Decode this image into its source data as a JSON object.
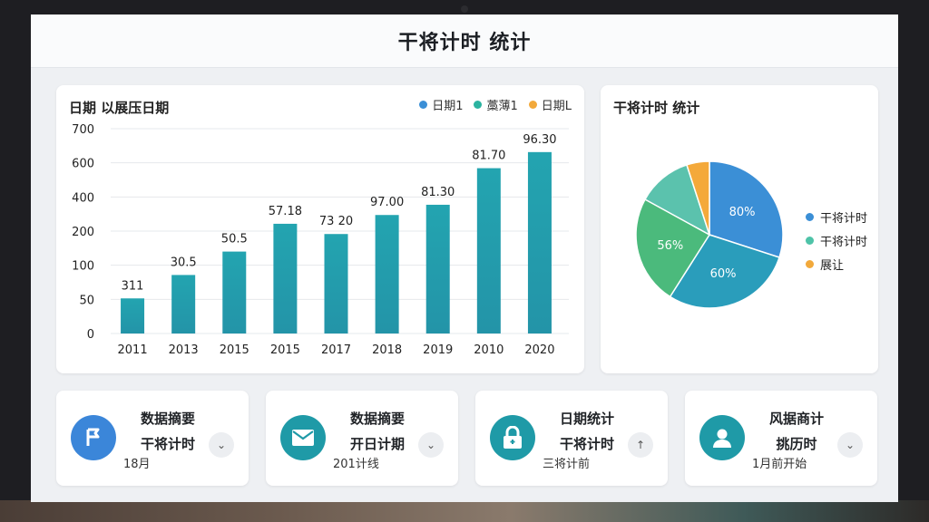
{
  "header": {
    "title": "干将计时 统计"
  },
  "bar_chart": {
    "title": "日期 以展压日期",
    "legend": [
      {
        "label": "日期1",
        "color": "#3b8fd6"
      },
      {
        "label": "藁薄1",
        "color": "#2bb3a0"
      },
      {
        "label": "日期L",
        "color": "#f2a93b"
      }
    ]
  },
  "pie_chart": {
    "title": "干将计时 统计",
    "legend": [
      {
        "label": "干将计时",
        "color": "#3b8fd6"
      },
      {
        "label": "干将计时",
        "color": "#4ec3a8"
      },
      {
        "label": "展让",
        "color": "#f2a93b"
      }
    ]
  },
  "chart_data": [
    {
      "type": "bar",
      "categories": [
        "2011",
        "2013",
        "2015",
        "2015",
        "2017",
        "2018",
        "2019",
        "2010",
        "2020"
      ],
      "values": [
        120,
        200,
        280,
        375,
        340,
        405,
        440,
        565,
        620
      ],
      "data_labels": [
        "311",
        "30.5",
        "50.5",
        "57.18",
        "73 20",
        "97.00",
        "81.30",
        "81.70",
        "96.30"
      ],
      "y_ticks": [
        "0",
        "50",
        "100",
        "200",
        "400",
        "600",
        "700"
      ],
      "ylim": [
        0,
        700
      ],
      "grid": true,
      "legend_position": "top-right"
    },
    {
      "type": "pie",
      "labels": [
        "80%",
        "60%",
        "56%",
        "",
        ""
      ],
      "values": [
        30,
        29,
        24,
        12,
        5
      ],
      "colors": [
        "#3b8fd6",
        "#2a9dbb",
        "#4bba7c",
        "#5bc2ad",
        "#f4a93a"
      ],
      "legend_position": "right"
    }
  ],
  "stats": [
    {
      "line1": "数据摘要",
      "line2": "干将计时",
      "line3": "18月",
      "icon": "flag-icon",
      "icon_color": "#3b86d9",
      "action": "chevron-down-icon"
    },
    {
      "line1": "数据摘要",
      "line2": "开日计期",
      "line3": "201计线",
      "icon": "mail-icon",
      "icon_color": "#1f9aa7",
      "action": "chevron-down-icon"
    },
    {
      "line1": "日期统计",
      "line2": "干将计时",
      "line3": "三将计前",
      "icon": "lock-icon",
      "icon_color": "#1f9aa7",
      "action": "arrow-up-icon"
    },
    {
      "line1": "风据商计",
      "line2": "挑历时",
      "line3": "1月前开始",
      "icon": "user-icon",
      "icon_color": "#1f9aa7",
      "action": "chevron-down-icon"
    }
  ]
}
